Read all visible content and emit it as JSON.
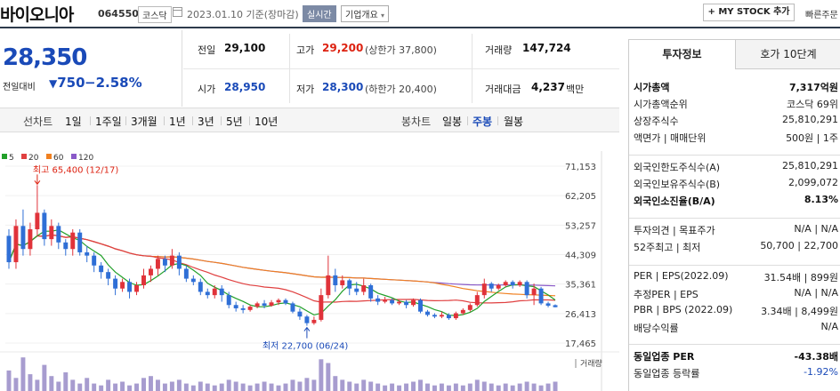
{
  "header": {
    "company_name": "바이오니아",
    "stock_code": "064550",
    "market": "코스닥",
    "date_basis": "2023.01.10 기준(장마감)",
    "realtime_label": "실시간",
    "company_info_label": "기업개요",
    "mystock_label": "+ MY STOCK 추가",
    "quick_view_label": "빠른주문"
  },
  "price": {
    "current": "28,350",
    "change_label": "전일대비",
    "change_amount": "750",
    "change_percent": "−2.58%"
  },
  "quote": {
    "prev_close_label": "전일",
    "prev_close": "29,100",
    "high_label": "고가",
    "high": "29,200",
    "upper_limit": "(상한가 37,800)",
    "volume_label": "거래량",
    "volume": "147,724",
    "open_label": "시가",
    "open": "28,950",
    "low_label": "저가",
    "low": "28,300",
    "lower_limit": "(하한가 20,400)",
    "amount_label": "거래대금",
    "amount": "4,237",
    "amount_unit": "백만"
  },
  "tabs": {
    "line_label": "선차트",
    "line_periods": [
      "1일",
      "1주일",
      "3개월",
      "1년",
      "3년",
      "5년",
      "10년"
    ],
    "candle_label": "봉차트",
    "candle_periods": [
      "일봉",
      "주봉",
      "월봉"
    ],
    "active_candle": "주봉"
  },
  "chart_data": {
    "type": "candlestick",
    "legend": [
      {
        "name": "5",
        "color": "#22a02a"
      },
      {
        "name": "20",
        "color": "#e04040"
      },
      {
        "name": "60",
        "color": "#f08020"
      },
      {
        "name": "120",
        "color": "#8a5ac8"
      }
    ],
    "ylim": [
      17465,
      71153
    ],
    "yticks": [
      "71,153",
      "62,205",
      "53,257",
      "44,309",
      "35,361",
      "26,413",
      "17,465"
    ],
    "high_annotation": "최고 65,400 (12/17)",
    "low_annotation": "최저 22,700 (06/24)",
    "volume_label": "거래량",
    "candles": [
      {
        "o": 50000,
        "c": 42000,
        "h": 52000,
        "l": 40000
      },
      {
        "o": 42000,
        "c": 53000,
        "h": 55000,
        "l": 40000
      },
      {
        "o": 53000,
        "c": 46000,
        "h": 58000,
        "l": 44000
      },
      {
        "o": 46000,
        "c": 52000,
        "h": 54000,
        "l": 44000
      },
      {
        "o": 52000,
        "c": 57000,
        "h": 65400,
        "l": 50000
      },
      {
        "o": 57000,
        "c": 49000,
        "h": 58000,
        "l": 47000
      },
      {
        "o": 49000,
        "c": 53000,
        "h": 55000,
        "l": 47000
      },
      {
        "o": 53000,
        "c": 48000,
        "h": 54000,
        "l": 46000
      },
      {
        "o": 48000,
        "c": 46000,
        "h": 49000,
        "l": 44000
      },
      {
        "o": 46000,
        "c": 51000,
        "h": 52000,
        "l": 44000
      },
      {
        "o": 51000,
        "c": 45000,
        "h": 52000,
        "l": 44000
      },
      {
        "o": 45000,
        "c": 44000,
        "h": 47000,
        "l": 42000
      },
      {
        "o": 44000,
        "c": 41000,
        "h": 45000,
        "l": 39000
      },
      {
        "o": 41000,
        "c": 39000,
        "h": 42000,
        "l": 37000
      },
      {
        "o": 39000,
        "c": 37000,
        "h": 40000,
        "l": 35000
      },
      {
        "o": 37000,
        "c": 34000,
        "h": 38000,
        "l": 32000
      },
      {
        "o": 34000,
        "c": 36000,
        "h": 37000,
        "l": 33000
      },
      {
        "o": 36000,
        "c": 33000,
        "h": 37000,
        "l": 31000
      },
      {
        "o": 33000,
        "c": 35000,
        "h": 36000,
        "l": 32000
      },
      {
        "o": 35000,
        "c": 38000,
        "h": 40000,
        "l": 34000
      },
      {
        "o": 38000,
        "c": 40000,
        "h": 41000,
        "l": 36000
      },
      {
        "o": 40000,
        "c": 43000,
        "h": 44000,
        "l": 38000
      },
      {
        "o": 43000,
        "c": 41000,
        "h": 44000,
        "l": 39000
      },
      {
        "o": 41000,
        "c": 44000,
        "h": 46000,
        "l": 40000
      },
      {
        "o": 44000,
        "c": 40000,
        "h": 45000,
        "l": 38000
      },
      {
        "o": 40000,
        "c": 37000,
        "h": 41000,
        "l": 36000
      },
      {
        "o": 37000,
        "c": 36000,
        "h": 38000,
        "l": 35000
      },
      {
        "o": 36000,
        "c": 33000,
        "h": 37000,
        "l": 32000
      },
      {
        "o": 33000,
        "c": 32000,
        "h": 34000,
        "l": 31000
      },
      {
        "o": 32000,
        "c": 34000,
        "h": 35000,
        "l": 31000
      },
      {
        "o": 34000,
        "c": 32000,
        "h": 35000,
        "l": 30000
      },
      {
        "o": 32000,
        "c": 29000,
        "h": 33000,
        "l": 28000
      },
      {
        "o": 29000,
        "c": 28000,
        "h": 30000,
        "l": 27000
      },
      {
        "o": 28000,
        "c": 27500,
        "h": 29000,
        "l": 26500
      },
      {
        "o": 27500,
        "c": 28500,
        "h": 29000,
        "l": 27000
      },
      {
        "o": 28500,
        "c": 29500,
        "h": 30000,
        "l": 28000
      },
      {
        "o": 29500,
        "c": 28800,
        "h": 30500,
        "l": 28000
      },
      {
        "o": 28800,
        "c": 29800,
        "h": 30500,
        "l": 28500
      },
      {
        "o": 29800,
        "c": 30500,
        "h": 31000,
        "l": 29000
      },
      {
        "o": 30500,
        "c": 29500,
        "h": 31000,
        "l": 29000
      },
      {
        "o": 29500,
        "c": 27000,
        "h": 30000,
        "l": 26500
      },
      {
        "o": 27000,
        "c": 25500,
        "h": 28000,
        "l": 24500
      },
      {
        "o": 25500,
        "c": 23500,
        "h": 26000,
        "l": 22700
      },
      {
        "o": 23500,
        "c": 24500,
        "h": 25500,
        "l": 23000
      },
      {
        "o": 24500,
        "c": 32000,
        "h": 34000,
        "l": 24000
      },
      {
        "o": 32000,
        "c": 38000,
        "h": 44000,
        "l": 31000
      },
      {
        "o": 38000,
        "c": 35000,
        "h": 40000,
        "l": 33000
      },
      {
        "o": 35000,
        "c": 36500,
        "h": 38000,
        "l": 34000
      },
      {
        "o": 36500,
        "c": 34000,
        "h": 37000,
        "l": 32000
      },
      {
        "o": 34000,
        "c": 33000,
        "h": 36000,
        "l": 32000
      },
      {
        "o": 33000,
        "c": 35000,
        "h": 37000,
        "l": 32000
      },
      {
        "o": 35000,
        "c": 31000,
        "h": 35500,
        "l": 30000
      },
      {
        "o": 31000,
        "c": 30000,
        "h": 32000,
        "l": 29000
      },
      {
        "o": 30000,
        "c": 30500,
        "h": 31500,
        "l": 29500
      },
      {
        "o": 30500,
        "c": 29500,
        "h": 31000,
        "l": 29000
      },
      {
        "o": 29500,
        "c": 30000,
        "h": 30500,
        "l": 29000
      },
      {
        "o": 30000,
        "c": 29000,
        "h": 30500,
        "l": 28000
      },
      {
        "o": 29000,
        "c": 30500,
        "h": 31000,
        "l": 28500
      },
      {
        "o": 30500,
        "c": 27000,
        "h": 31000,
        "l": 26500
      },
      {
        "o": 27000,
        "c": 26000,
        "h": 27500,
        "l": 25500
      },
      {
        "o": 26000,
        "c": 25500,
        "h": 26500,
        "l": 25000
      },
      {
        "o": 25500,
        "c": 26000,
        "h": 27000,
        "l": 25000
      },
      {
        "o": 26000,
        "c": 25000,
        "h": 26500,
        "l": 24500
      },
      {
        "o": 25000,
        "c": 26500,
        "h": 27000,
        "l": 24500
      },
      {
        "o": 26500,
        "c": 27500,
        "h": 28000,
        "l": 26000
      },
      {
        "o": 27500,
        "c": 29000,
        "h": 29500,
        "l": 27000
      },
      {
        "o": 29000,
        "c": 32000,
        "h": 33000,
        "l": 28500
      },
      {
        "o": 32000,
        "c": 35500,
        "h": 37000,
        "l": 31000
      },
      {
        "o": 35500,
        "c": 34000,
        "h": 36000,
        "l": 33000
      },
      {
        "o": 34000,
        "c": 35000,
        "h": 35500,
        "l": 33500
      },
      {
        "o": 35000,
        "c": 36000,
        "h": 36500,
        "l": 34500
      },
      {
        "o": 36000,
        "c": 35000,
        "h": 36500,
        "l": 34000
      },
      {
        "o": 35000,
        "c": 36000,
        "h": 36500,
        "l": 34500
      },
      {
        "o": 36000,
        "c": 32000,
        "h": 36500,
        "l": 31000
      },
      {
        "o": 32000,
        "c": 34000,
        "h": 35500,
        "l": 29000
      },
      {
        "o": 34000,
        "c": 29500,
        "h": 34500,
        "l": 29000
      },
      {
        "o": 29500,
        "c": 28800,
        "h": 30000,
        "l": 28300
      },
      {
        "o": 28950,
        "c": 28350,
        "h": 29200,
        "l": 28300
      }
    ],
    "volumes": [
      0.55,
      0.35,
      0.9,
      0.45,
      0.3,
      0.7,
      0.4,
      0.25,
      0.5,
      0.3,
      0.2,
      0.35,
      0.2,
      0.15,
      0.3,
      0.2,
      0.25,
      0.15,
      0.2,
      0.35,
      0.4,
      0.3,
      0.2,
      0.25,
      0.3,
      0.2,
      0.15,
      0.25,
      0.2,
      0.15,
      0.2,
      0.3,
      0.25,
      0.2,
      0.15,
      0.2,
      0.25,
      0.2,
      0.15,
      0.2,
      0.3,
      0.25,
      0.35,
      0.3,
      0.85,
      0.75,
      0.4,
      0.3,
      0.25,
      0.2,
      0.3,
      0.25,
      0.2,
      0.15,
      0.2,
      0.15,
      0.2,
      0.25,
      0.3,
      0.2,
      0.15,
      0.2,
      0.15,
      0.2,
      0.15,
      0.2,
      0.3,
      0.25,
      0.2,
      0.15,
      0.2,
      0.15,
      0.2,
      0.25,
      0.2,
      0.15,
      0.2,
      0.25
    ]
  },
  "invest": {
    "tab_invest": "투자정보",
    "tab_quote": "호가 10단계",
    "rows1": [
      {
        "label": "시가총액",
        "value": "7,317억원",
        "bold": true
      },
      {
        "label": "시가총액순위",
        "value": "코스닥 69위"
      },
      {
        "label": "상장주식수",
        "value": "25,810,291"
      },
      {
        "label": "액면가 | 매매단위",
        "value": "500원 | 1주"
      }
    ],
    "rows2": [
      {
        "label": "외국인한도주식수(A)",
        "value": "25,810,291"
      },
      {
        "label": "외국인보유주식수(B)",
        "value": "2,099,072"
      },
      {
        "label": "외국인소진율(B/A)",
        "value": "8.13%",
        "bold": true
      }
    ],
    "rows3": [
      {
        "label": "투자의견 | 목표주가",
        "value": "N/A | N/A"
      },
      {
        "label": "52주최고 | 최저",
        "value": "50,700 | 22,700"
      }
    ],
    "rows4": [
      {
        "label": "PER | EPS(2022.09)",
        "value": "31.54배 | 899원"
      },
      {
        "label": "추정PER | EPS",
        "value": "N/A | N/A"
      },
      {
        "label": "PBR | BPS (2022.09)",
        "value": "3.34배 | 8,499원"
      },
      {
        "label": "배당수익률",
        "value": "N/A"
      }
    ],
    "rows5": [
      {
        "label": "동일업종 PER",
        "value": "-43.38배",
        "bold": true
      },
      {
        "label": "동일업종 등락률",
        "value": "-1.92%",
        "blue": true
      }
    ]
  }
}
